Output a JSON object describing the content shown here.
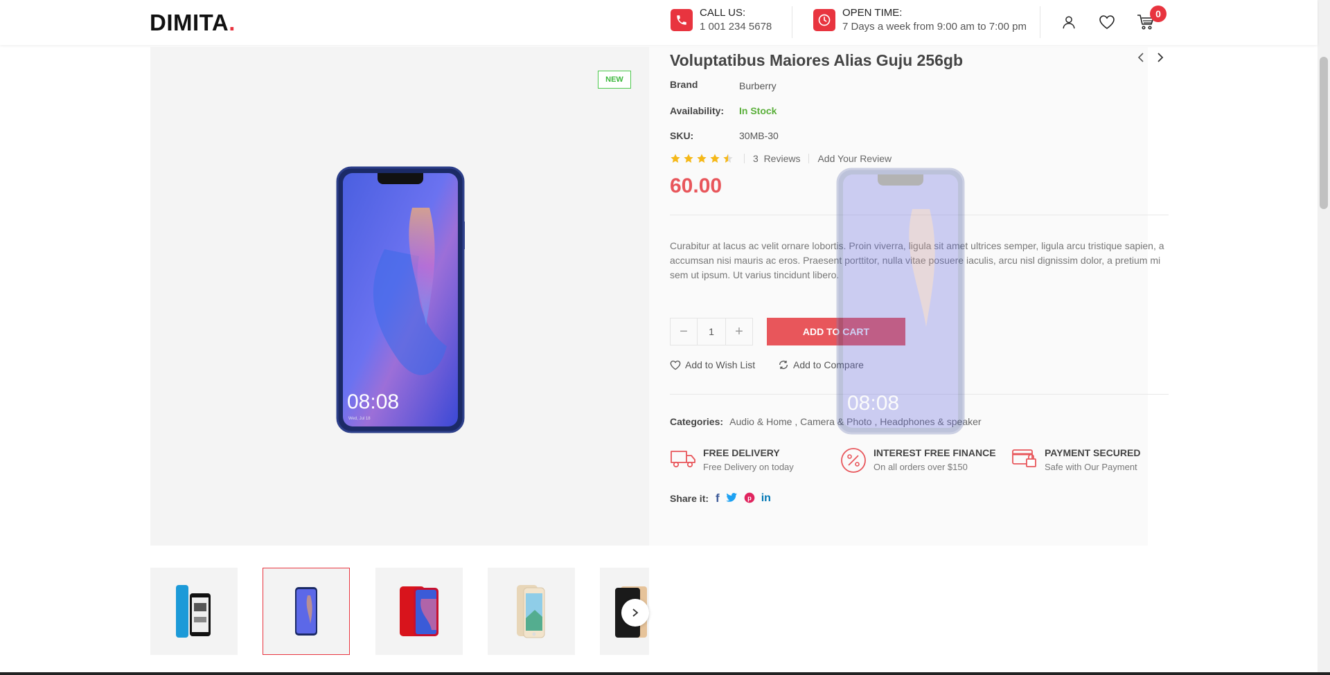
{
  "header": {
    "logo_text": "DIMITA",
    "logo_dot": ".",
    "call": {
      "title": "CALL US:",
      "value": "1 001 234 5678"
    },
    "open": {
      "title": "OPEN TIME:",
      "value": "7 Days a week from 9:00 am to 7:00 pm"
    },
    "cart_count": "0"
  },
  "gallery": {
    "badge": "NEW"
  },
  "product": {
    "title": "Voluptatibus Maiores Alias Guju 256gb",
    "brand_label": "Brand",
    "brand": "Burberry",
    "availability_label": "Availability:",
    "availability": "In Stock",
    "sku_label": "SKU:",
    "sku": "30MB-30",
    "rating": 4.5,
    "reviews": "3  Reviews",
    "add_review": "Add Your Review",
    "price": "60.00",
    "description": "Curabitur at lacus ac velit ornare lobortis. Proin viverra, ligula sit amet ultrices semper, ligula arcu tristique sapien, a accumsan nisi mauris ac eros. Praesent porttitor, nulla vitae posuere iaculis, arcu nisl dignissim dolor, a pretium mi sem ut ipsum. Ut varius tincidunt libero.",
    "quantity": "1",
    "minus": "−",
    "plus": "+",
    "add_to_cart": "ADD TO CART",
    "wishlist": "Add to Wish List",
    "compare": "Add to Compare",
    "categories_label": "Categories:",
    "categories": "Audio & Home , Camera & Photo , Headphones & speaker",
    "share_label": "Share it:",
    "share_icons": [
      "f",
      "t",
      "p",
      "in"
    ]
  },
  "features": [
    {
      "title": "FREE DELIVERY",
      "sub": "Free Delivery on today"
    },
    {
      "title": "INTEREST FREE FINANCE",
      "sub": "On all orders over $150"
    },
    {
      "title": "PAYMENT SECURED",
      "sub": "Safe with Our Payment"
    }
  ],
  "phone_screen": {
    "time": "08:08",
    "date": "Wed, Jul 18"
  },
  "colors": {
    "accent": "#e8343f",
    "price": "#e8565b",
    "stock": "#5aaf3a",
    "new_badge": "#3db83d"
  }
}
